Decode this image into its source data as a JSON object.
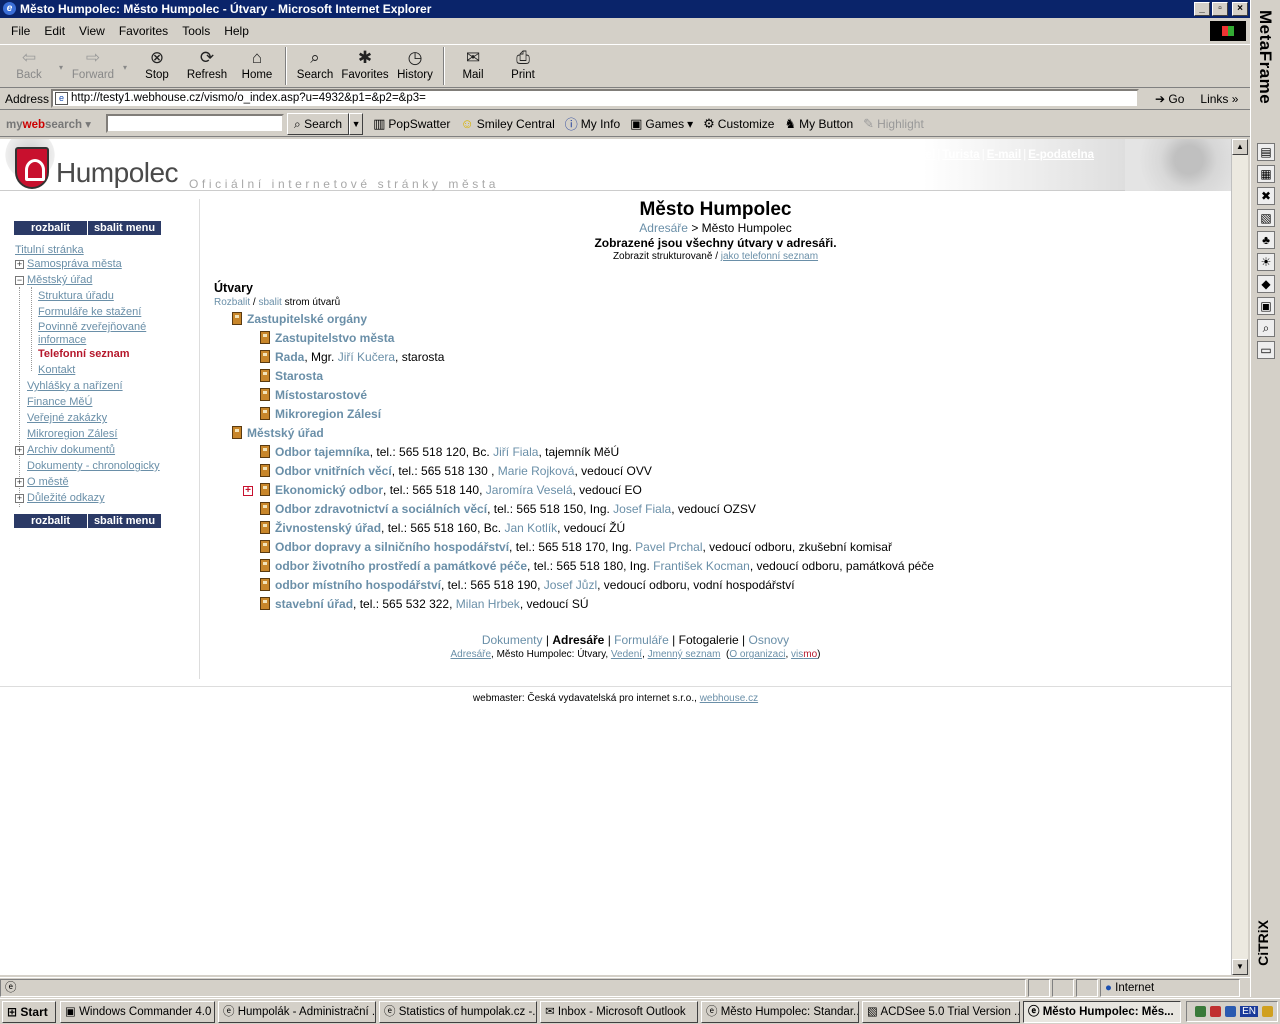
{
  "window": {
    "title": "Město Humpolec: Město Humpolec - Útvary - Microsoft Internet Explorer",
    "min": "_",
    "max": "▫",
    "close": "×"
  },
  "menu": [
    "File",
    "Edit",
    "View",
    "Favorites",
    "Tools",
    "Help"
  ],
  "toolbar": {
    "back": "Back",
    "forward": "Forward",
    "stop": "Stop",
    "refresh": "Refresh",
    "home": "Home",
    "search": "Search",
    "favorites": "Favorites",
    "history": "History",
    "mail": "Mail",
    "print": "Print"
  },
  "address": {
    "label": "Address",
    "url": "http://testy1.webhouse.cz/vismo/o_index.asp?u=4932&p1=&p2=&p3=",
    "go": "Go",
    "links": "Links"
  },
  "searchbar": {
    "brand_prefix": "my",
    "brand_main": "web",
    "brand_suffix": "search",
    "search_button": "Search",
    "items": [
      "PopSwatter",
      "Smiley Central",
      "My Info",
      "Games",
      "Customize",
      "My Button",
      "Highlight"
    ]
  },
  "site": {
    "name": "Humpolec",
    "tagline": "Oficiální internetové stránky města",
    "top_links": [
      "Úřední deska",
      "Občan",
      "Podnikatel",
      "Turista",
      "E-mail",
      "E-podatelna"
    ]
  },
  "sidebar": {
    "expand": "rozbalit",
    "collapse": "sbalit menu",
    "items": [
      "Titulní stránka",
      "Samospráva města",
      "Městský úřad",
      "Struktura úřadu",
      "Formuláře ke stažení",
      "Povinně zveřejňované",
      "informace",
      "Telefonní seznam",
      "Kontakt",
      "Vyhlášky a nařízení",
      "Finance MěÚ",
      "Veřejné zakázky",
      "Mikroregion Zálesí",
      "Archiv dokumentů",
      "Dokumenty - chronologicky",
      "O městě",
      "Důležité odkazy"
    ]
  },
  "content": {
    "title": "Město Humpolec",
    "crumb_link": "Adresáře",
    "crumb_rest": " > Město Humpolec",
    "shown_all": "Zobrazené jsou všechny útvary v adresáři.",
    "display_prefix": "Zobrazit strukturovaně / ",
    "display_link": "jako telefonní seznam",
    "section": "Útvary",
    "expand_link": "Rozbalit",
    "expand_sep": " / ",
    "collapse_link": "sbalit",
    "expand_suffix": " strom útvarů"
  },
  "tree": [
    {
      "unit": "Zastupitelské orgány",
      "rest": "",
      "person": "",
      "tail": ""
    },
    {
      "unit": "Zastupitelstvo města",
      "rest": "",
      "person": "",
      "tail": ""
    },
    {
      "unit": "Rada",
      "rest": ", Mgr. ",
      "person": "Jiří Kučera",
      "tail": ", starosta"
    },
    {
      "unit": "Starosta",
      "rest": "",
      "person": "",
      "tail": ""
    },
    {
      "unit": "Místostarostové",
      "rest": "",
      "person": "",
      "tail": ""
    },
    {
      "unit": "Mikroregion Zálesí",
      "rest": "",
      "person": "",
      "tail": ""
    },
    {
      "unit": "Městský úřad",
      "rest": "",
      "person": "",
      "tail": ""
    },
    {
      "unit": "Odbor tajemníka",
      "rest": ", tel.: 565 518 120, Bc. ",
      "person": "Jiří Fiala",
      "tail": ", tajemník MěÚ"
    },
    {
      "unit": "Odbor vnitřních věcí",
      "rest": ", tel.: 565 518 130 , ",
      "person": "Marie Rojková",
      "tail": ", vedoucí OVV"
    },
    {
      "unit": "Ekonomický odbor",
      "rest": ", tel.: 565 518 140, ",
      "person": "Jaromíra Veselá",
      "tail": ", vedoucí EO"
    },
    {
      "unit": "Odbor zdravotnictví a sociálních věcí",
      "rest": ", tel.: 565 518 150, Ing. ",
      "person": "Josef Fiala",
      "tail": ", vedoucí OZSV"
    },
    {
      "unit": "Živnostenský úřad",
      "rest": ", tel.: 565 518 160, Bc. ",
      "person": "Jan Kotlík",
      "tail": ", vedoucí ŽÚ"
    },
    {
      "unit": "Odbor dopravy a silničního hospodářství",
      "rest": ", tel.: 565 518 170, Ing. ",
      "person": "Pavel Prchal",
      "tail": ", vedoucí odboru, zkušební komisař"
    },
    {
      "unit": "odbor životního prostředí a památkové péče",
      "rest": ", tel.: 565 518 180, Ing. ",
      "person": "František Kocman",
      "tail": ", vedoucí odboru, památková péče"
    },
    {
      "unit": "odbor místního hospodářství",
      "rest": ", tel.: 565 518 190, ",
      "person": "Josef Jůzl",
      "tail": ", vedoucí odboru, vodní hospodářství"
    },
    {
      "unit": "stavební úřad",
      "rest": ", tel.: 565 532 322, ",
      "person": "Milan Hrbek",
      "tail": ", vedoucí SÚ"
    }
  ],
  "footer": {
    "nav_documents": "Dokumenty",
    "nav_directories": "Adresáře",
    "nav_forms": "Formuláře",
    "nav_gallery": "Fotogalerie",
    "nav_polls": "Osnovy",
    "sub_directories": "Adresáře",
    "sub_text": ", Město Humpolec: Útvary, ",
    "sub_management": "Vedení",
    "sub_sep": ", ",
    "sub_names": "Jmenný seznam",
    "sub_about": "O organizaci",
    "sub_vis": "vis",
    "sub_mo": "mo",
    "webmaster_text": "webmaster: Česká vydavatelská pro internet s.r.o., ",
    "webmaster_link": "webhouse.cz"
  },
  "status": {
    "zone": "Internet"
  },
  "metaframe": {
    "logo": "MetaFrame",
    "citrix": "CiTRiX"
  },
  "taskbar": {
    "start": "Start",
    "tasks": [
      "Windows Commander 4.0 ...",
      "Humpolák - Administrační ...",
      "Statistics of humpolak.cz -...",
      "Inbox - Microsoft Outlook",
      "Město Humpolec: Standar...",
      "ACDSee 5.0 Trial Version ...",
      "Město Humpolec: Měs..."
    ],
    "tray_lang": "EN"
  }
}
